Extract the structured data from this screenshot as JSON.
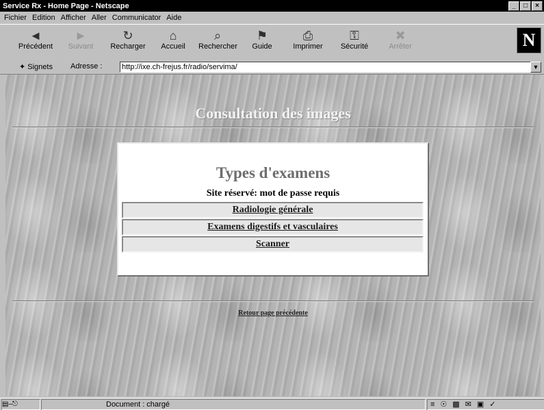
{
  "window": {
    "title": "Service Rx - Home Page - Netscape",
    "icon": "netscape-window-icon"
  },
  "window_buttons": [
    "_",
    "□",
    "×"
  ],
  "menu": [
    "Fichier",
    "Edition",
    "Afficher",
    "Aller",
    "Communicator",
    "Aide"
  ],
  "toolbar": [
    {
      "label": "Précédent",
      "icon": "back-arrow-icon",
      "glyph": "◄",
      "enabled": true
    },
    {
      "label": "Suivant",
      "icon": "forward-arrow-icon",
      "glyph": "►",
      "enabled": false
    },
    {
      "label": "Recharger",
      "icon": "reload-icon",
      "glyph": "↻",
      "enabled": true
    },
    {
      "label": "Accueil",
      "icon": "home-icon",
      "glyph": "⌂",
      "enabled": true
    },
    {
      "label": "Rechercher",
      "icon": "search-icon",
      "glyph": "⌕",
      "enabled": true
    },
    {
      "label": "Guide",
      "icon": "guide-icon",
      "glyph": "⚑",
      "enabled": true
    },
    {
      "label": "Imprimer",
      "icon": "print-icon",
      "glyph": "⎙",
      "enabled": true
    },
    {
      "label": "Sécurité",
      "icon": "security-lock-icon",
      "glyph": "⚿",
      "enabled": true
    },
    {
      "label": "Arrêter",
      "icon": "stop-icon",
      "glyph": "✖",
      "enabled": false
    }
  ],
  "brand_logo": "N",
  "location": {
    "bookmarks_label": "Signets",
    "address_label": "Adresse :",
    "url": "http://ixe.ch-frejus.fr/radio/servima/"
  },
  "page": {
    "heading": "Consultation des images",
    "panel_title": "Types d'examens",
    "panel_note": "Site réservé: mot de passe requis",
    "options": [
      "Radiologie générale",
      "Examens digestifs et vasculaires",
      "Scanner"
    ],
    "back_link": "Retour page précédente"
  },
  "status": {
    "text": "Document : chargé"
  }
}
